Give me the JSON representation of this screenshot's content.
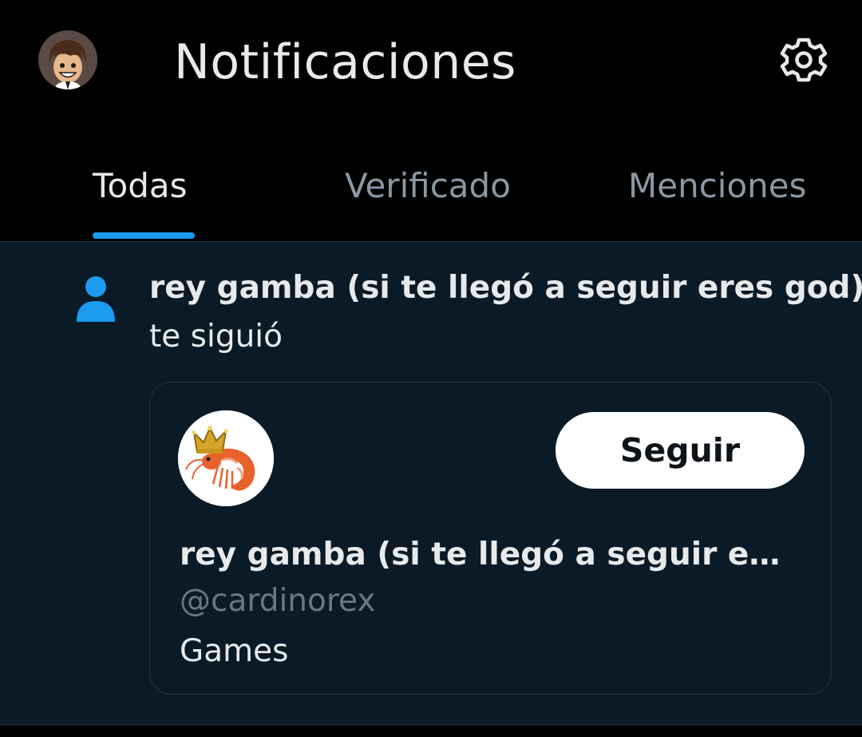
{
  "header": {
    "title": "Notificaciones",
    "avatar_icon": "user-avatar-icon",
    "settings_icon": "gear-icon"
  },
  "tabs": [
    {
      "label": "Todas",
      "active": true
    },
    {
      "label": "Verificado",
      "active": false
    },
    {
      "label": "Menciones",
      "active": false
    }
  ],
  "notification": {
    "icon": "person-icon",
    "title": "rey gamba (si te llegó a seguir eres god)",
    "subtitle": "te siguió",
    "card": {
      "avatar_icon": "crowned-shrimp-avatar",
      "follow_label": "Seguir",
      "name": "rey gamba (si te llegó a seguir ere...",
      "handle": "@cardinorex",
      "bio": "Games"
    }
  },
  "colors": {
    "background": "#000000",
    "notification_background": "#0a1b27",
    "accent": "#1d9bf0",
    "text_primary": "#e7e9ea",
    "text_secondary": "#8b98a5",
    "handle": "#6e767d",
    "button_bg": "#ffffff",
    "button_text": "#0f1419"
  }
}
